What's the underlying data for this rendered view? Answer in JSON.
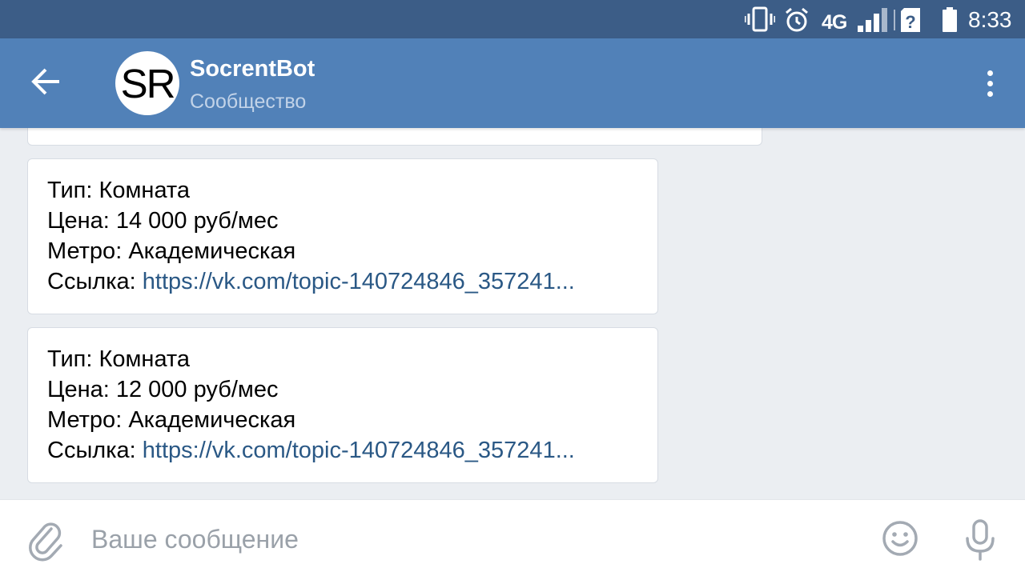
{
  "status_bar": {
    "network": "4G",
    "time": "8:33",
    "icons": [
      "vibrate-icon",
      "alarm-icon",
      "signal-icon",
      "no-sim-icon",
      "battery-icon"
    ]
  },
  "header": {
    "avatar_text": "SR",
    "title": "SocrentBot",
    "subtitle": "Сообщество",
    "back_icon": "arrow-back-icon",
    "menu_icon": "more-vertical-icon"
  },
  "messages": [
    {
      "type_label": "Тип:",
      "type_value": "Комната",
      "price_label": "Цена:",
      "price_value": "14 000 руб/мес",
      "metro_label": "Метро:",
      "metro_value": "Академическая",
      "link_label": "Ссылка:",
      "link_value": "https://vk.com/topic-140724846_357241..."
    },
    {
      "type_label": "Тип:",
      "type_value": "Комната",
      "price_label": "Цена:",
      "price_value": "12 000 руб/мес",
      "metro_label": "Метро:",
      "metro_value": "Академическая",
      "link_label": "Ссылка:",
      "link_value": "https://vk.com/topic-140724846_357241..."
    }
  ],
  "composer": {
    "placeholder": "Ваше сообщение",
    "icons": [
      "paperclip-icon",
      "emoji-icon",
      "microphone-icon"
    ]
  },
  "colors": {
    "status_bar": "#3c5d87",
    "header": "#5181b8",
    "background": "#ebeef2",
    "link": "#2a5885"
  }
}
